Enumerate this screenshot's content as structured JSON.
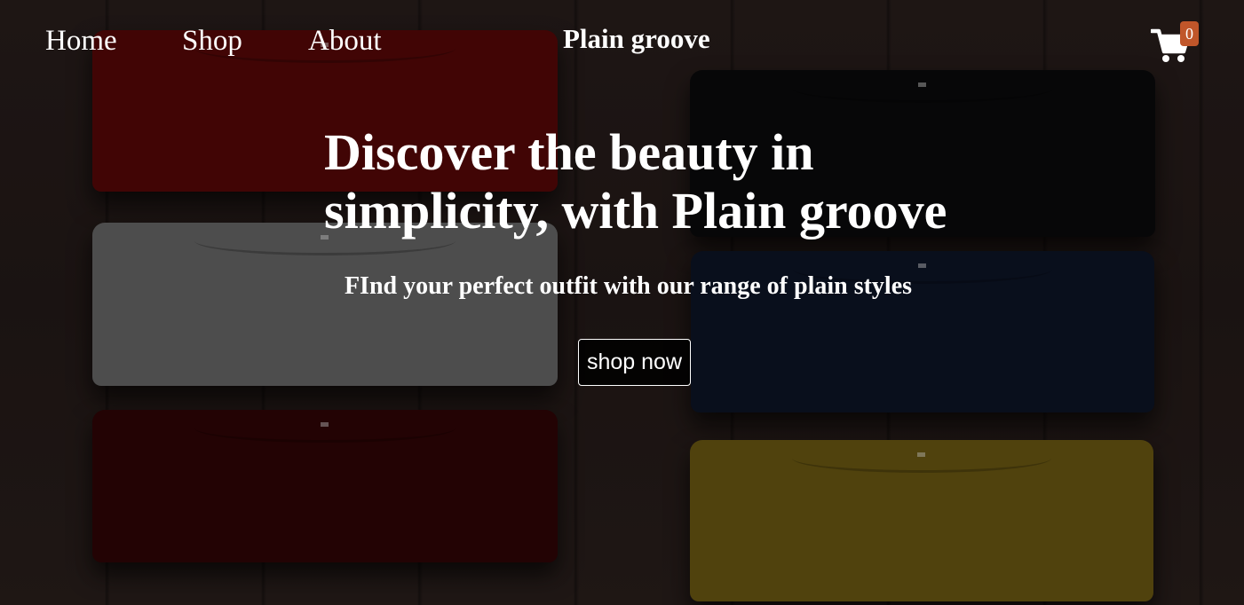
{
  "nav": {
    "items": [
      {
        "label": "Home"
      },
      {
        "label": "Shop"
      },
      {
        "label": "About"
      }
    ]
  },
  "brand": {
    "name": "Plain groove"
  },
  "cart": {
    "count": "0",
    "icon": "shopping-cart-icon",
    "badge_color": "#c0562a"
  },
  "hero": {
    "title": "Discover the beauty in simplicity, with Plain groove",
    "subtitle": "FInd your perfect outfit with our range of plain styles",
    "cta_label": "shop now"
  },
  "background": {
    "description_colors": [
      "#5a0808",
      "#0b0b0c",
      "#6b6b6b",
      "#0d1528",
      "#310506",
      "#6f5c12"
    ]
  }
}
